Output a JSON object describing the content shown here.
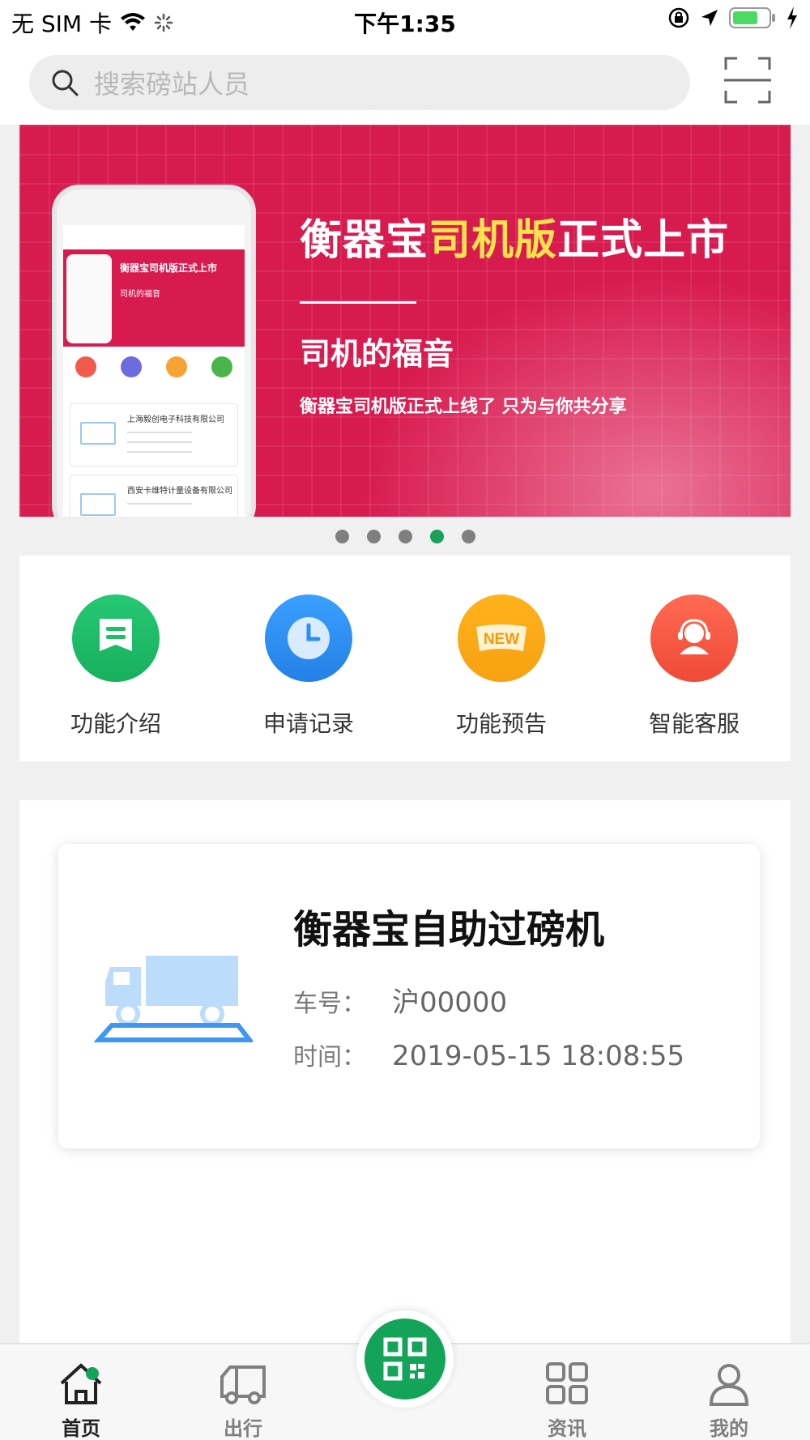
{
  "status_bar": {
    "carrier": "无 SIM 卡",
    "time": "下午1:35"
  },
  "search": {
    "placeholder": "搜索磅站人员"
  },
  "banner": {
    "title_prefix": "衡器宝",
    "title_highlight": "司机版",
    "title_suffix": "正式上市",
    "subtitle": "司机的福音",
    "description": "衡器宝司机版正式上线了 只为与你共分享",
    "mock_phone": {
      "mini_title": "衡器宝司机版正式上市",
      "mini_sub": "司机的福音",
      "card1_company": "上海毅创电子科技有限公司",
      "card2_company": "西安卡维特计量设备有限公司"
    },
    "dots_total": 5,
    "active_dot_index": 3
  },
  "quick_menu": [
    {
      "label": "功能介绍",
      "icon": "intro-icon",
      "color": "#1fbf6a"
    },
    {
      "label": "申请记录",
      "icon": "clock-icon",
      "color": "#2f8ff0"
    },
    {
      "label": "功能预告",
      "icon": "new-badge-icon",
      "color": "#fbae17"
    },
    {
      "label": "智能客服",
      "icon": "service-agent-icon",
      "color": "#f4553f"
    }
  ],
  "scale_card": {
    "title": "衡器宝自助过磅机",
    "plate_label": "车号：",
    "plate_value": "沪00000",
    "time_label": "时间：",
    "time_value": "2019-05-15 18:08:55"
  },
  "tab_bar": [
    {
      "label": "首页",
      "icon": "home-icon",
      "active": true
    },
    {
      "label": "出行",
      "icon": "truck-icon",
      "active": false
    },
    {
      "label": "资讯",
      "icon": "grid-icon",
      "active": false
    },
    {
      "label": "我的",
      "icon": "person-icon",
      "active": false
    }
  ],
  "colors": {
    "brand_green": "#13a45a",
    "banner_red": "#d81b4f",
    "highlight_yellow": "#ffe34d"
  }
}
